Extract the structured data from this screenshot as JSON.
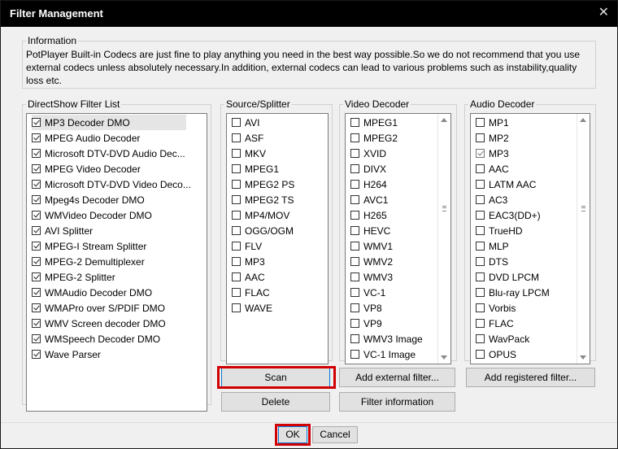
{
  "window": {
    "title": "Filter Management",
    "close_glyph": "✕"
  },
  "information": {
    "legend": "Information",
    "text": "PotPlayer Built-in Codecs are just fine to play anything you need in the best way possible.So we do not recommend that you use external codecs unless absolutely necessary.In addition, external codecs can lead to various problems such as instability,quality loss etc."
  },
  "directshow": {
    "legend": "DirectShow Filter List",
    "items": [
      {
        "label": "MP3 Decoder DMO",
        "checked": true,
        "selected": true
      },
      {
        "label": "MPEG Audio Decoder",
        "checked": true
      },
      {
        "label": "Microsoft DTV-DVD Audio Dec...",
        "checked": true
      },
      {
        "label": "MPEG Video Decoder",
        "checked": true
      },
      {
        "label": "Microsoft DTV-DVD Video Deco...",
        "checked": true
      },
      {
        "label": "Mpeg4s Decoder DMO",
        "checked": true
      },
      {
        "label": "WMVideo Decoder DMO",
        "checked": true
      },
      {
        "label": "AVI Splitter",
        "checked": true
      },
      {
        "label": "MPEG-I Stream Splitter",
        "checked": true
      },
      {
        "label": "MPEG-2 Demultiplexer",
        "checked": true
      },
      {
        "label": "MPEG-2 Splitter",
        "checked": true
      },
      {
        "label": "WMAudio Decoder DMO",
        "checked": true
      },
      {
        "label": "WMAPro over S/PDIF DMO",
        "checked": true
      },
      {
        "label": "WMV Screen decoder DMO",
        "checked": true
      },
      {
        "label": "WMSpeech Decoder DMO",
        "checked": true
      },
      {
        "label": "Wave Parser",
        "checked": true
      }
    ]
  },
  "source_splitter": {
    "legend": "Source/Splitter",
    "items": [
      {
        "label": "AVI"
      },
      {
        "label": "ASF"
      },
      {
        "label": "MKV"
      },
      {
        "label": "MPEG1"
      },
      {
        "label": "MPEG2 PS"
      },
      {
        "label": "MPEG2 TS"
      },
      {
        "label": "MP4/MOV"
      },
      {
        "label": "OGG/OGM"
      },
      {
        "label": "FLV"
      },
      {
        "label": "MP3"
      },
      {
        "label": "AAC"
      },
      {
        "label": "FLAC"
      },
      {
        "label": "WAVE"
      }
    ]
  },
  "video_decoder": {
    "legend": "Video Decoder",
    "items": [
      {
        "label": "MPEG1"
      },
      {
        "label": "MPEG2"
      },
      {
        "label": "XVID"
      },
      {
        "label": "DIVX"
      },
      {
        "label": "H264"
      },
      {
        "label": "AVC1"
      },
      {
        "label": "H265"
      },
      {
        "label": "HEVC"
      },
      {
        "label": "WMV1"
      },
      {
        "label": "WMV2"
      },
      {
        "label": "WMV3"
      },
      {
        "label": "VC-1"
      },
      {
        "label": "VP8"
      },
      {
        "label": "VP9"
      },
      {
        "label": "WMV3 Image"
      },
      {
        "label": "VC-1 Image"
      }
    ]
  },
  "audio_decoder": {
    "legend": "Audio Decoder",
    "items": [
      {
        "label": "MP1"
      },
      {
        "label": "MP2"
      },
      {
        "label": "MP3",
        "checked": true,
        "gray": true
      },
      {
        "label": "AAC"
      },
      {
        "label": "LATM AAC"
      },
      {
        "label": "AC3"
      },
      {
        "label": "EAC3(DD+)"
      },
      {
        "label": "TrueHD"
      },
      {
        "label": "MLP"
      },
      {
        "label": "DTS"
      },
      {
        "label": "DVD LPCM"
      },
      {
        "label": "Blu-ray LPCM"
      },
      {
        "label": "Vorbis"
      },
      {
        "label": "FLAC"
      },
      {
        "label": "WavPack"
      },
      {
        "label": "OPUS"
      }
    ]
  },
  "buttons": {
    "scan": "Scan",
    "add_external": "Add external filter...",
    "add_registered": "Add registered filter...",
    "delete": "Delete",
    "filter_info": "Filter information",
    "ok": "OK",
    "cancel": "Cancel"
  },
  "highlight_color": "#d00000"
}
